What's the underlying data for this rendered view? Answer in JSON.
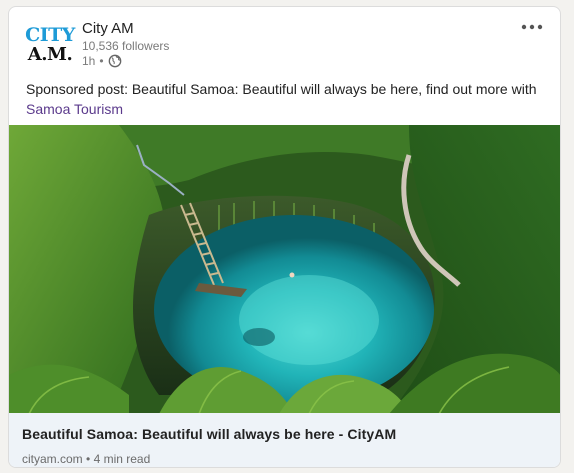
{
  "post": {
    "company": {
      "logo_line1": "CITY",
      "logo_line2": "A.M.",
      "name": "City AM",
      "followers": "10,536 followers",
      "time": "1h",
      "dot": "•"
    },
    "more_icon": "ellipsis-icon",
    "text_prefix": "Sponsored post: Beautiful Samoa: Beautiful will always be here, find out more with ",
    "text_link": "Samoa Tourism",
    "image_icon": "photo-of-samoa-ocean-trench",
    "preview": {
      "title": "Beautiful Samoa: Beautiful will always be here - CityAM",
      "source": "cityam.com",
      "separator": " • ",
      "read_time": "4 min read"
    }
  },
  "colors": {
    "logo_blue": "#1e9bd7",
    "link_purple": "#5b3a8c",
    "preview_bg": "#eef3f8"
  }
}
